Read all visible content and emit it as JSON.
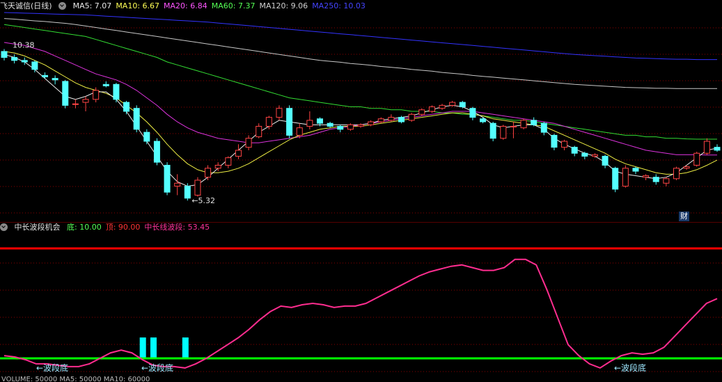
{
  "main_panel": {
    "title": "飞天诚信(日线)",
    "indicators": [
      {
        "label": "MA5: 7.07",
        "color": "#e8e8e8"
      },
      {
        "label": "MA10: 6.67",
        "color": "#ffff55"
      },
      {
        "label": "MA20: 6.84",
        "color": "#ff55ff"
      },
      {
        "label": "MA60: 7.37",
        "color": "#55ff55"
      },
      {
        "label": "MA120: 9.06",
        "color": "#d0d0d0"
      },
      {
        "label": "MA250: 10.03",
        "color": "#4444ff"
      }
    ],
    "high_label": "10.38",
    "low_label": "←5.32",
    "finance_badge": "财"
  },
  "sub_panel": {
    "title": "中长波段机会",
    "indicators": [
      {
        "label": "底: 10.00",
        "color": "#55ff55"
      },
      {
        "label": "顶: 90.00",
        "color": "#ff3333"
      },
      {
        "label": "中长线波段: 53.45",
        "color": "#ff3399"
      }
    ],
    "bottom_labels": [
      "←波段底",
      "←波段底",
      "←波段底"
    ]
  },
  "bottom_row_text": "VOLUME: 50000 MA5: 50000 MA10: 60000",
  "colors": {
    "up": "#ff4444",
    "down": "#54ffff",
    "grid": "#8b0000",
    "top_line": "#ff0000",
    "bottom_line": "#00ff00",
    "wave_line": "#ff2d8f",
    "bar_signal": "#00ffff"
  },
  "chart_data": {
    "type": "candlestick",
    "candles": [
      [
        10.3,
        10.1,
        10.38,
        10.0
      ],
      [
        10.1,
        10.0,
        10.2,
        9.9
      ],
      [
        10.0,
        9.95,
        10.1,
        9.85
      ],
      [
        9.95,
        9.7,
        10.0,
        9.6
      ],
      [
        9.5,
        9.45,
        9.6,
        9.4
      ],
      [
        9.4,
        9.35,
        9.5,
        9.2
      ],
      [
        9.3,
        8.5,
        9.35,
        8.4
      ],
      [
        8.55,
        8.55,
        8.7,
        8.4
      ],
      [
        8.6,
        8.7,
        8.8,
        8.3
      ],
      [
        8.7,
        9.0,
        9.1,
        8.6
      ],
      [
        9.2,
        9.15,
        9.3,
        9.1
      ],
      [
        9.2,
        8.7,
        9.25,
        8.6
      ],
      [
        8.6,
        8.3,
        8.65,
        8.2
      ],
      [
        8.4,
        7.7,
        8.5,
        7.6
      ],
      [
        7.6,
        7.3,
        7.7,
        7.2
      ],
      [
        7.3,
        6.6,
        7.4,
        6.5
      ],
      [
        6.5,
        5.6,
        6.6,
        5.5
      ],
      [
        5.8,
        5.9,
        6.2,
        5.5
      ],
      [
        5.8,
        5.4,
        5.9,
        5.32
      ],
      [
        5.5,
        6.0,
        6.1,
        5.45
      ],
      [
        6.1,
        6.4,
        6.5,
        6.0
      ],
      [
        6.4,
        6.5,
        6.6,
        6.3
      ],
      [
        6.5,
        6.75,
        6.8,
        6.4
      ],
      [
        6.8,
        7.0,
        7.2,
        6.7
      ],
      [
        7.1,
        7.4,
        7.5,
        7.0
      ],
      [
        7.45,
        7.8,
        7.9,
        7.4
      ],
      [
        7.8,
        8.1,
        8.15,
        7.7
      ],
      [
        8.1,
        8.4,
        8.5,
        8.0
      ],
      [
        8.4,
        7.5,
        8.5,
        7.4
      ],
      [
        7.5,
        7.75,
        7.9,
        7.4
      ],
      [
        7.8,
        8.0,
        8.3,
        7.7
      ],
      [
        8.05,
        7.9,
        8.1,
        7.8
      ],
      [
        7.9,
        7.8,
        7.95,
        7.75
      ],
      [
        7.8,
        7.7,
        7.85,
        7.6
      ],
      [
        7.7,
        7.85,
        7.9,
        7.65
      ],
      [
        7.8,
        7.85,
        7.9,
        7.75
      ],
      [
        7.85,
        7.95,
        8.0,
        7.8
      ],
      [
        7.95,
        8.05,
        8.1,
        7.9
      ],
      [
        8.0,
        8.1,
        8.2,
        7.95
      ],
      [
        8.1,
        7.95,
        8.15,
        7.9
      ],
      [
        8.0,
        8.2,
        8.25,
        7.95
      ],
      [
        8.2,
        8.35,
        8.4,
        8.15
      ],
      [
        8.3,
        8.45,
        8.5,
        8.25
      ],
      [
        8.4,
        8.5,
        8.55,
        8.35
      ],
      [
        8.5,
        8.6,
        8.65,
        8.45
      ],
      [
        8.6,
        8.45,
        8.65,
        8.4
      ],
      [
        8.4,
        8.1,
        8.45,
        8.0
      ],
      [
        8.05,
        7.95,
        8.1,
        7.9
      ],
      [
        7.9,
        7.4,
        7.95,
        7.3
      ],
      [
        7.4,
        7.8,
        7.85,
        7.35
      ],
      [
        7.8,
        7.8,
        7.95,
        7.4
      ],
      [
        7.75,
        8.0,
        8.05,
        7.7
      ],
      [
        8.0,
        7.85,
        8.1,
        7.8
      ],
      [
        7.9,
        7.6,
        7.95,
        7.5
      ],
      [
        7.5,
        7.1,
        7.55,
        7.0
      ],
      [
        7.1,
        7.3,
        7.35,
        7.0
      ],
      [
        7.1,
        6.9,
        7.15,
        6.8
      ],
      [
        6.9,
        6.8,
        6.95,
        6.7
      ],
      [
        6.8,
        6.85,
        6.9,
        6.75
      ],
      [
        6.8,
        6.5,
        6.85,
        6.4
      ],
      [
        6.4,
        5.7,
        6.45,
        5.6
      ],
      [
        5.8,
        6.4,
        6.5,
        5.75
      ],
      [
        6.4,
        6.3,
        6.45,
        6.2
      ],
      [
        6.1,
        6.15,
        6.2,
        6.0
      ],
      [
        6.1,
        5.95,
        6.2,
        5.85
      ],
      [
        5.9,
        6.05,
        6.1,
        5.8
      ],
      [
        6.05,
        6.4,
        6.45,
        6.0
      ],
      [
        6.4,
        6.45,
        6.5,
        6.35
      ],
      [
        6.5,
        6.9,
        6.95,
        6.45
      ],
      [
        6.9,
        7.3,
        7.4,
        6.85
      ],
      [
        7.1,
        7.0,
        7.2,
        6.95
      ]
    ],
    "ma5": [
      10.2,
      10.1,
      9.95,
      9.7,
      9.4,
      9.1,
      8.8,
      8.7,
      8.8,
      8.95,
      8.95,
      8.7,
      8.3,
      7.8,
      7.3,
      6.8,
      6.3,
      5.95,
      5.8,
      5.85,
      6.1,
      6.4,
      6.7,
      7.0,
      7.3,
      7.6,
      7.8,
      8.0,
      7.95,
      7.9,
      7.85,
      7.85,
      7.85,
      7.85,
      7.85,
      7.85,
      7.9,
      8.0,
      8.05,
      8.1,
      8.15,
      8.25,
      8.35,
      8.45,
      8.5,
      8.45,
      8.3,
      8.1,
      7.85,
      7.75,
      7.8,
      7.85,
      7.85,
      7.7,
      7.4,
      7.2,
      7.05,
      6.9,
      6.8,
      6.6,
      6.3,
      6.2,
      6.15,
      6.1,
      6.05,
      6.1,
      6.25,
      6.5,
      6.75,
      7.0,
      7.07
    ],
    "ma10": [
      10.3,
      10.25,
      10.15,
      10.0,
      9.85,
      9.65,
      9.45,
      9.25,
      9.1,
      9.0,
      8.9,
      8.75,
      8.5,
      8.25,
      7.95,
      7.6,
      7.2,
      6.85,
      6.55,
      6.35,
      6.25,
      6.25,
      6.3,
      6.4,
      6.55,
      6.75,
      6.95,
      7.15,
      7.35,
      7.5,
      7.6,
      7.7,
      7.75,
      7.8,
      7.8,
      7.8,
      7.85,
      7.9,
      7.95,
      8.0,
      8.05,
      8.1,
      8.15,
      8.2,
      8.25,
      8.25,
      8.2,
      8.15,
      8.05,
      8.0,
      7.95,
      7.9,
      7.85,
      7.8,
      7.65,
      7.5,
      7.35,
      7.2,
      7.05,
      6.9,
      6.7,
      6.55,
      6.45,
      6.35,
      6.25,
      6.2,
      6.2,
      6.25,
      6.35,
      6.5,
      6.67
    ],
    "ma20": [
      10.6,
      10.55,
      10.5,
      10.4,
      10.3,
      10.15,
      10.0,
      9.85,
      9.7,
      9.55,
      9.45,
      9.35,
      9.2,
      9.0,
      8.75,
      8.5,
      8.2,
      7.95,
      7.75,
      7.6,
      7.5,
      7.4,
      7.35,
      7.3,
      7.25,
      7.25,
      7.3,
      7.35,
      7.4,
      7.45,
      7.5,
      7.6,
      7.7,
      7.75,
      7.8,
      7.85,
      7.9,
      7.95,
      8.0,
      8.05,
      8.1,
      8.15,
      8.2,
      8.25,
      8.3,
      8.3,
      8.3,
      8.25,
      8.2,
      8.15,
      8.1,
      8.05,
      8.0,
      7.95,
      7.9,
      7.8,
      7.7,
      7.6,
      7.5,
      7.4,
      7.3,
      7.2,
      7.1,
      7.0,
      6.95,
      6.9,
      6.85,
      6.85,
      6.85,
      6.84,
      6.84
    ],
    "ma60": [
      11.2,
      11.15,
      11.1,
      11.05,
      11.0,
      10.95,
      10.9,
      10.85,
      10.8,
      10.7,
      10.6,
      10.5,
      10.4,
      10.3,
      10.2,
      10.1,
      9.95,
      9.85,
      9.75,
      9.65,
      9.55,
      9.45,
      9.35,
      9.25,
      9.15,
      9.05,
      8.95,
      8.85,
      8.75,
      8.7,
      8.65,
      8.6,
      8.55,
      8.5,
      8.45,
      8.45,
      8.4,
      8.4,
      8.35,
      8.35,
      8.3,
      8.3,
      8.3,
      8.25,
      8.25,
      8.2,
      8.2,
      8.15,
      8.1,
      8.05,
      8.0,
      8.0,
      7.95,
      7.9,
      7.85,
      7.8,
      7.75,
      7.7,
      7.65,
      7.6,
      7.55,
      7.5,
      7.5,
      7.45,
      7.45,
      7.4,
      7.4,
      7.38,
      7.37,
      7.37,
      7.37
    ],
    "ma120": [
      11.4,
      11.38,
      11.35,
      11.32,
      11.3,
      11.27,
      11.24,
      11.2,
      11.15,
      11.1,
      11.05,
      11.0,
      10.95,
      10.9,
      10.85,
      10.8,
      10.75,
      10.7,
      10.65,
      10.6,
      10.55,
      10.5,
      10.45,
      10.4,
      10.35,
      10.3,
      10.25,
      10.2,
      10.15,
      10.1,
      10.05,
      10.0,
      9.97,
      9.94,
      9.9,
      9.87,
      9.84,
      9.8,
      9.77,
      9.74,
      9.7,
      9.67,
      9.64,
      9.6,
      9.57,
      9.54,
      9.5,
      9.47,
      9.44,
      9.41,
      9.38,
      9.35,
      9.32,
      9.29,
      9.26,
      9.23,
      9.2,
      9.18,
      9.16,
      9.14,
      9.12,
      9.1,
      9.09,
      9.08,
      9.07,
      9.07,
      9.06,
      9.06,
      9.06,
      9.06,
      9.06
    ],
    "ma250": [
      11.6,
      11.59,
      11.58,
      11.57,
      11.56,
      11.55,
      11.54,
      11.53,
      11.52,
      11.5,
      11.48,
      11.46,
      11.44,
      11.42,
      11.4,
      11.38,
      11.36,
      11.34,
      11.32,
      11.3,
      11.28,
      11.25,
      11.22,
      11.19,
      11.16,
      11.13,
      11.1,
      11.07,
      11.04,
      11.01,
      10.98,
      10.95,
      10.92,
      10.89,
      10.86,
      10.83,
      10.8,
      10.77,
      10.74,
      10.71,
      10.68,
      10.65,
      10.62,
      10.59,
      10.56,
      10.53,
      10.5,
      10.47,
      10.44,
      10.41,
      10.38,
      10.35,
      10.32,
      10.29,
      10.26,
      10.23,
      10.2,
      10.18,
      10.16,
      10.14,
      10.12,
      10.1,
      10.08,
      10.07,
      10.06,
      10.05,
      10.04,
      10.04,
      10.03,
      10.03,
      10.03
    ],
    "ylim": [
      5.0,
      11.6
    ],
    "wave": [
      12,
      11,
      9,
      6,
      6,
      5,
      4,
      4,
      6,
      10,
      14,
      16,
      14,
      9,
      5,
      4,
      4,
      3,
      6,
      10,
      15,
      20,
      25,
      31,
      38,
      44,
      48,
      47,
      49,
      50,
      49,
      47,
      48,
      48,
      50,
      54,
      58,
      62,
      66,
      70,
      73,
      75,
      77,
      78,
      76,
      74,
      74,
      76,
      82,
      82,
      78,
      60,
      40,
      20,
      12,
      6,
      3,
      8,
      12,
      14,
      13,
      14,
      18,
      26,
      34,
      42,
      50,
      53.45
    ],
    "wave_ylim": [
      0,
      100
    ],
    "signal_bars_index": [
      13,
      14,
      17
    ]
  }
}
